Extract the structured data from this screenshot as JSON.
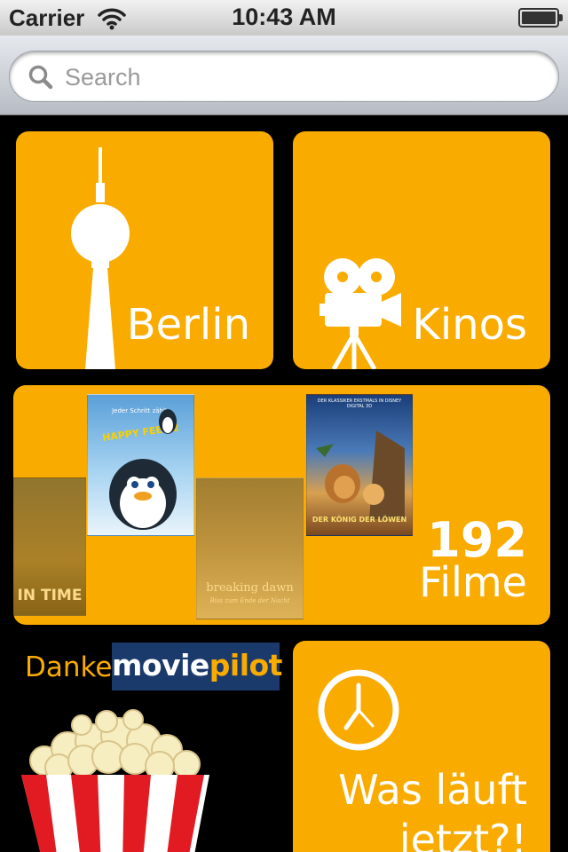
{
  "status_bar": {
    "carrier": "Carrier",
    "time": "10:43 AM"
  },
  "search": {
    "placeholder": "Search"
  },
  "tiles": {
    "berlin": {
      "label": "Berlin",
      "icon": "tv-tower-icon"
    },
    "kinos": {
      "label": "Kinos",
      "icon": "movie-camera-icon"
    },
    "filme": {
      "count": "192",
      "label": "Filme",
      "posters": [
        {
          "name": "In Time",
          "title": "IN TIME",
          "tagline": ""
        },
        {
          "name": "Happy Feet 2",
          "title": "HAPPY FEET 2",
          "tagline": "Jeder Schritt zählt."
        },
        {
          "name": "Breaking Dawn",
          "title": "breaking dawn",
          "tagline": "Biss zum Ende der Nacht"
        },
        {
          "name": "Der König der Löwen",
          "title": "DER KÖNIG DER LÖWEN",
          "tagline": "DER KLASSIKER ERSTMALS IN DISNEY DIGITAL 3D"
        }
      ]
    },
    "jetzt": {
      "label": "Was läuft jetzt?!",
      "icon": "clock-icon"
    }
  },
  "danke": {
    "label": "Danke",
    "logo_movie": "movie",
    "logo_pilot": "pilot"
  },
  "colors": {
    "tile": "#f9ab00",
    "background": "#000000",
    "logo_bg": "#1b3a6c"
  }
}
